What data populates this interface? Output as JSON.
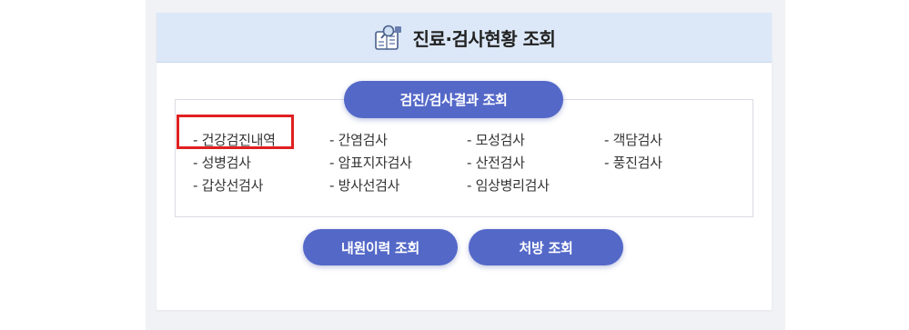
{
  "header": {
    "title": "진료·검사현황 조회",
    "icon": "medical-record-search-icon"
  },
  "buttons": {
    "results_label": "검진/검사결과 조회",
    "visit_history_label": "내원이력 조회",
    "prescription_label": "처방 조회"
  },
  "exams": {
    "col1": [
      "- 건강검진내역",
      "- 성병검사",
      "- 갑상선검사"
    ],
    "col2": [
      "- 간염검사",
      "- 암표지자검사",
      "- 방사선검사"
    ],
    "col3": [
      "- 모성검사",
      "- 산전검사",
      "- 임상병리검사"
    ],
    "col4": [
      "- 객담검사",
      "- 풍진검사"
    ]
  },
  "highlighted_item": "건강검진내역",
  "colors": {
    "accent": "#5468c8",
    "header_bg": "#dce8f8",
    "highlight": "#e02020"
  }
}
